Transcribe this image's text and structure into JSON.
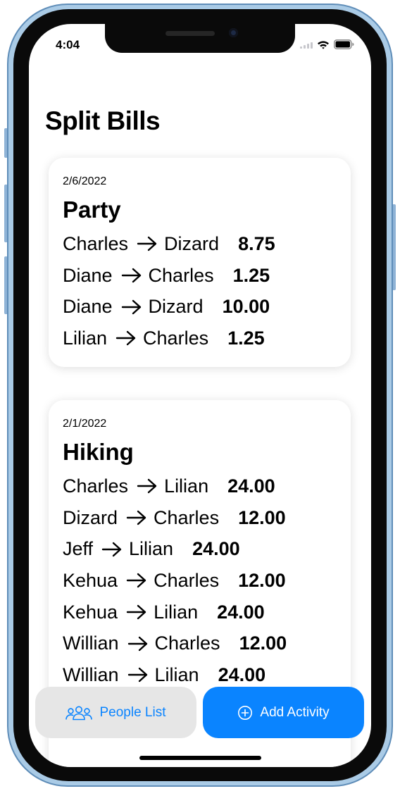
{
  "status_bar": {
    "time": "4:04"
  },
  "header": {
    "title": "Split Bills"
  },
  "activities": [
    {
      "date": "2/6/2022",
      "name": "Party",
      "transfers": [
        {
          "from": "Charles",
          "to": "Dizard",
          "amount": "8.75"
        },
        {
          "from": "Diane",
          "to": "Charles",
          "amount": "1.25"
        },
        {
          "from": "Diane",
          "to": "Dizard",
          "amount": "10.00"
        },
        {
          "from": "Lilian",
          "to": "Charles",
          "amount": "1.25"
        }
      ]
    },
    {
      "date": "2/1/2022",
      "name": "Hiking",
      "transfers": [
        {
          "from": "Charles",
          "to": "Lilian",
          "amount": "24.00"
        },
        {
          "from": "Dizard",
          "to": "Charles",
          "amount": "12.00"
        },
        {
          "from": "Jeff",
          "to": "Lilian",
          "amount": "24.00"
        },
        {
          "from": "Kehua",
          "to": "Charles",
          "amount": "12.00"
        },
        {
          "from": "Kehua",
          "to": "Lilian",
          "amount": "24.00"
        },
        {
          "from": "Willian",
          "to": "Charles",
          "amount": "12.00"
        },
        {
          "from": "Willian",
          "to": "Lilian",
          "amount": "24.00"
        }
      ]
    }
  ],
  "actions": {
    "people_list": {
      "label": "People List",
      "icon": "people-icon"
    },
    "add_activity": {
      "label": "Add Activity",
      "icon": "plus-circle-icon"
    }
  },
  "colors": {
    "accent": "#0a84ff",
    "secondary_button_bg": "#e6e6e6"
  }
}
